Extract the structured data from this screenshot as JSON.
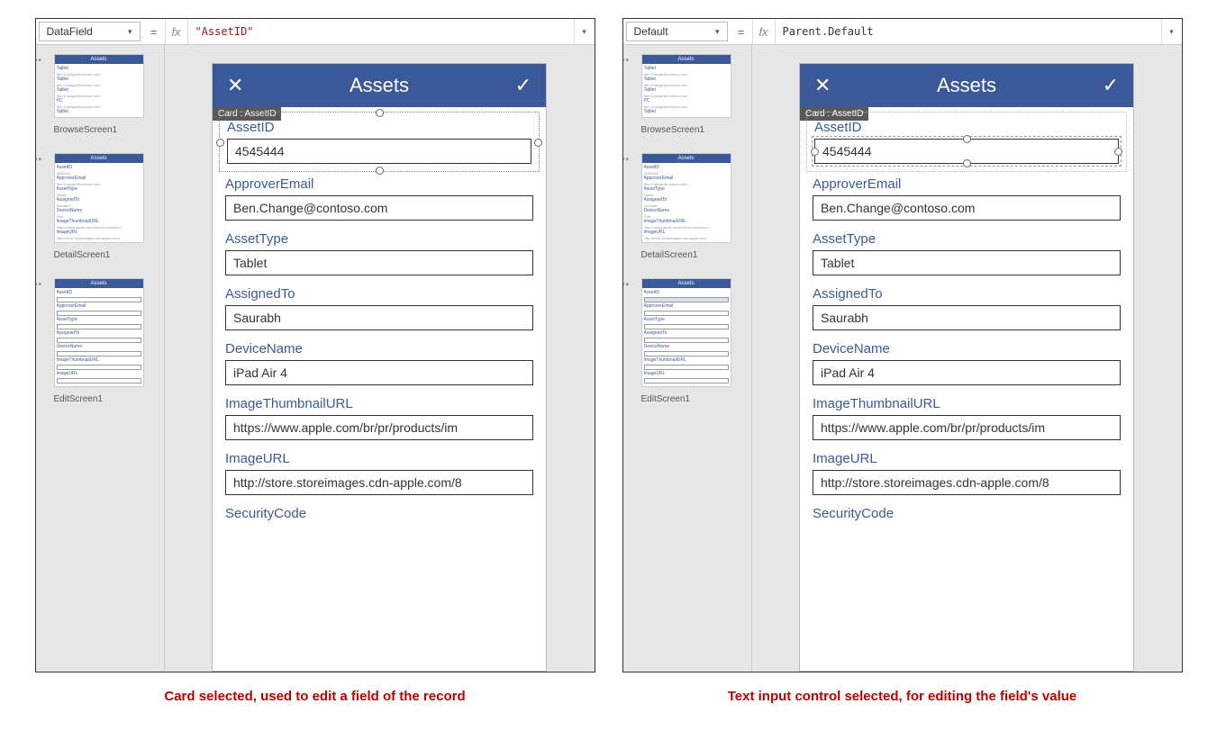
{
  "panel_left": {
    "property": "DataField",
    "formula": "\"AssetID\"",
    "caption": "Card selected, used to edit a field of the record"
  },
  "panel_right": {
    "property": "Default",
    "formula": "Parent.Default",
    "caption": "Text input control selected, for editing the field's value"
  },
  "thumbs": {
    "browse": "BrowseScreen1",
    "detail": "DetailScreen1",
    "edit": "EditScreen1",
    "head": "Assets"
  },
  "phone": {
    "title": "Assets",
    "badge": "Card : AssetID",
    "fields": [
      {
        "label": "AssetID",
        "value": "4545444"
      },
      {
        "label": "ApproverEmail",
        "value": "Ben.Change@contoso.com"
      },
      {
        "label": "AssetType",
        "value": "Tablet"
      },
      {
        "label": "AssignedTo",
        "value": "Saurabh"
      },
      {
        "label": "DeviceName",
        "value": "iPad Air 4"
      },
      {
        "label": "ImageThumbnailURL",
        "value": "https://www.apple.com/br/pr/products/im"
      },
      {
        "label": "ImageURL",
        "value": "http://store.storeimages.cdn-apple.com/8"
      },
      {
        "label": "SecurityCode",
        "value": ""
      }
    ]
  }
}
